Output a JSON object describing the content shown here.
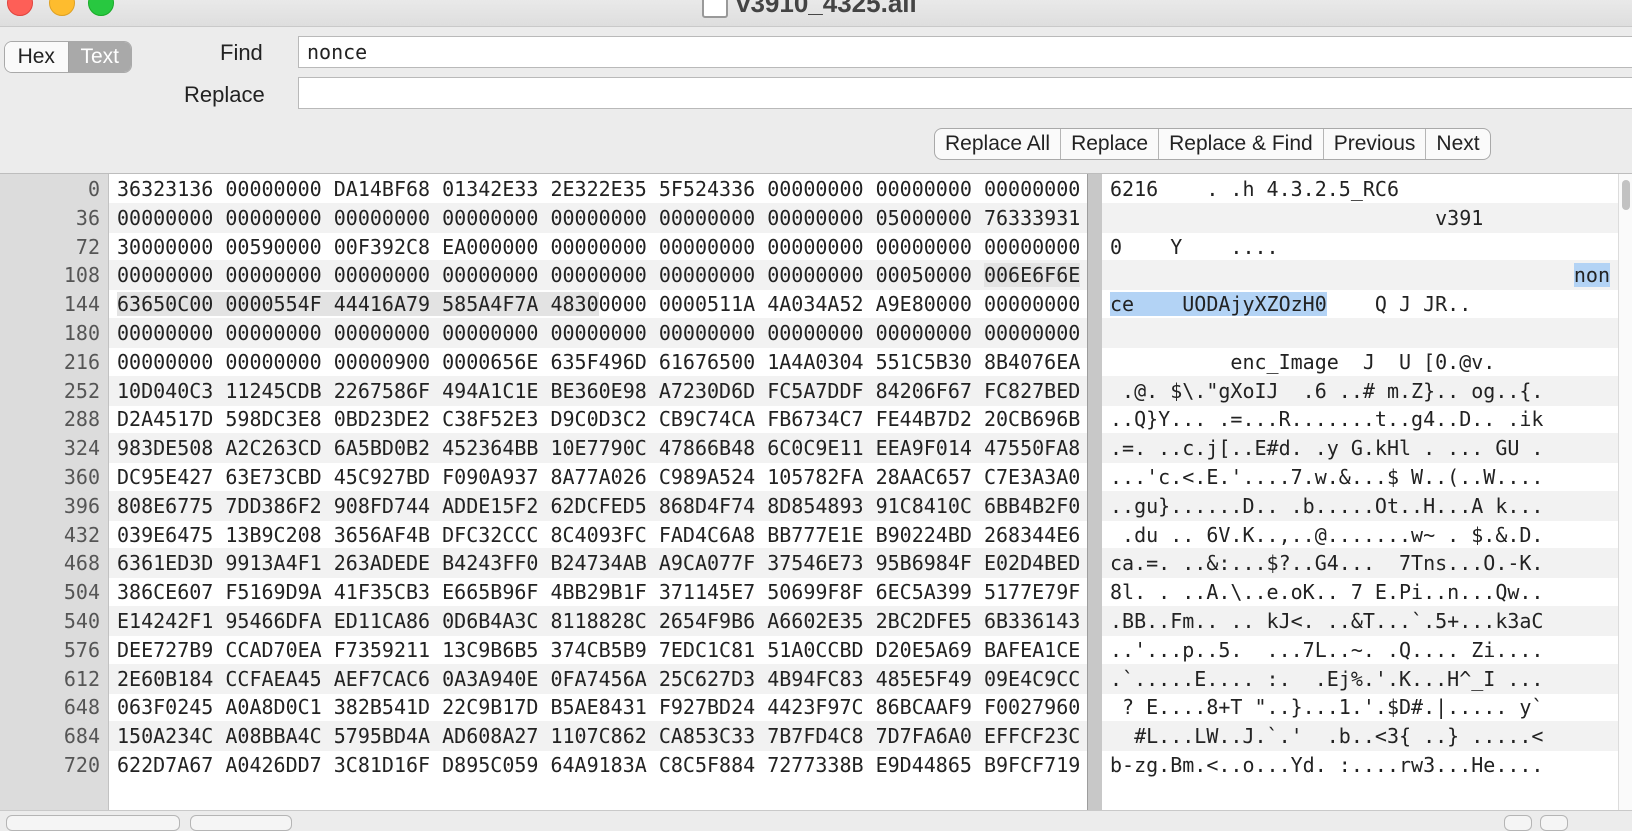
{
  "window": {
    "title": "v3910_4325.ali"
  },
  "mode_toggle": {
    "hex_label": "Hex",
    "text_label": "Text",
    "selected": "Text"
  },
  "find": {
    "label": "Find",
    "value": "nonce"
  },
  "replace": {
    "label": "Replace",
    "value": ""
  },
  "buttons": {
    "replace_all": "Replace All",
    "replace": "Replace",
    "replace_find": "Replace & Find",
    "previous": "Previous",
    "next": "Next"
  },
  "offsets": [
    "0",
    "36",
    "72",
    "108",
    "144",
    "180",
    "216",
    "252",
    "288",
    "324",
    "360",
    "396",
    "432",
    "468",
    "504",
    "540",
    "576",
    "612",
    "648",
    "684",
    "720"
  ],
  "hex_rows": [
    "36323136 00000000 DA14BF68 01342E33 2E322E35 5F524336 00000000 00000000 00000000",
    "00000000 00000000 00000000 00000000 00000000 00000000 00000000 05000000 76333931",
    "30000000 00590000 00F392C8 EA000000 00000000 00000000 00000000 00000000 00000000",
    "00000000 00000000 00000000 00000000 00000000 00000000 00000000 00050000 006E6F6E",
    "63650C00 0000554F 44416A79 585A4F7A 48300000 0000511A 4A034A52 A9E80000 00000000",
    "00000000 00000000 00000000 00000000 00000000 00000000 00000000 00000000 00000000",
    "00000000 00000000 00000900 0000656E 635F496D 61676500 1A4A0304 551C5B30 8B4076EA",
    "10D040C3 11245CDB 2267586F 494A1C1E BE360E98 A7230D6D FC5A7DDF 84206F67 FC827BED",
    "D2A4517D 598DC3E8 0BD23DE2 C38F52E3 D9C0D3C2 CB9C74CA FB6734C7 FE44B7D2 20CB696B",
    "983DE508 A2C263CD 6A5BD0B2 452364BB 10E7790C 47866B48 6C0C9E11 EEA9F014 47550FA8",
    "DC95E427 63E73CBD 45C927BD F090A937 8A77A026 C989A524 105782FA 28AAC657 C7E3A3A0",
    "808E6775 7DD386F2 908FD744 ADDE15F2 62DCFED5 868D4F74 8D854893 91C8410C 6BB4B2F0",
    "039E6475 13B9C208 3656AF4B DFC32CCC 8C4093FC FAD4C6A8 BB777E1E B90224BD 268344E6",
    "6361ED3D 9913A4F1 263ADEDE B4243FF0 B24734AB A9CA077F 37546E73 95B6984F E02D4BED",
    "386CE607 F5169D9A 41F35CB3 E665B96F 4BB29B1F 371145E7 50699F8F 6EC5A399 5177E79F",
    "E14242F1 95466DFA ED11CA86 0D6B4A3C 8118828C 2654F9B6 A6602E35 2BC2DFE5 6B336143",
    "DEE727B9 CCAD70EA F7359211 13C9B6B5 374CB5B9 7EDC1C81 51A0CCBD D20E5A69 BAFEA1CE",
    "2E60B184 CCFAEA45 AEF7CAC6 0A3A940E 0FA7456A 25C627D3 4B94FC83 485E5F49 09E4C9CC",
    "063F0245 A0A8D0C1 382B541D 22C9B17D B5AE8431 F927BD24 4423F97C 86BCAAF9 F0027960",
    "150A234C A08BBA4C 5795BD4A AD608A27 1107C862 CA853C33 7B7FD4C8 7D7FA6A0 EFFCF23C",
    "622D7A67 A0426DD7 3C81D16F D895C059 64A9183A C8C5F884 7277338B E9D44865 B9FCF719"
  ],
  "hex_row3_prefix": "00000000 00000000 00000000 00000000 00000000 00000000 00000000 00050000 ",
  "hex_row3_sel": "006E6F6E",
  "hex_row4_sel": "63650C00 0000554F 44416A79 585A4F7A 4830",
  "hex_row4_rest": "0000 0000511A 4A034A52 A9E80000 00000000",
  "ascii_rows": [
    "6216    . .h 4.3.2.5_RC6",
    "                           v391",
    "0    Y    ....",
    "",
    "",
    "",
    "          enc_Image  J  U [0.@v.",
    " .@. $\\.\"gXoIJ  .6 ..# m.Z}.. og..{.",
    "..Q}Y... .=...R.......t..g4..D.. .ik",
    ".=. ..c.j[..E#d. .y G.kHl . ... GU .",
    "...'c.<.E.'....7.w.&...$ W..(..W....",
    "..gu}......D.. .b.....Ot..H...A k...",
    " .du .. 6V.K..,..@.......w~ . $.&.D.",
    "ca.=. ..&:...$?..G4...  7Tns...O.-K.",
    "8l. . ..A.\\..e.oK.. 7 E.Pi..n...Qw..",
    ".BB..Fm.. .. kJ<. ..&T...`.5+...k3aC",
    "..'...p..5.  ...7L..~. .Q.... Zi....",
    ".`.....E.... :.  .Ej%.'.K...H^_I ...",
    " ? E....8+T \"..}...1.'.$D#.|..... y`",
    "  #L...LW..J.`.'  .b..<3{ ..} .....<",
    "b-zg.Bm.<..o...Yd. :....rw3...He...."
  ],
  "ascii_row3_sel": "non",
  "ascii_row4_sel": "ce    UODAjyXZOzH0",
  "ascii_row4_rest": "    Q J JR.."
}
